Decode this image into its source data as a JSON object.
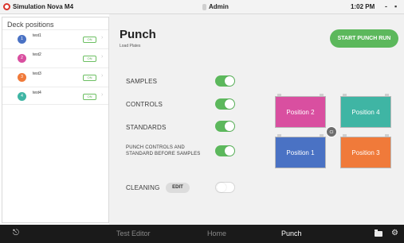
{
  "titlebar": {
    "app_name": "Simulation Nova M4",
    "user": "Admin",
    "time": "1:02 PM",
    "minimize": "-",
    "restore": "▪"
  },
  "sidebar": {
    "title": "Deck positions",
    "items": [
      {
        "num": "1",
        "name": "test1",
        "status": "ON",
        "color": "#4a72c4"
      },
      {
        "num": "2",
        "name": "test2",
        "status": "ON",
        "color": "#d94fa0"
      },
      {
        "num": "3",
        "name": "test3",
        "status": "ON",
        "color": "#f07a3a"
      },
      {
        "num": "4",
        "name": "test4",
        "status": "ON",
        "color": "#3fb5a4"
      }
    ]
  },
  "main": {
    "title": "Punch",
    "subtitle": "Load Plates",
    "start_button": "START PUNCH RUN",
    "options": [
      {
        "label": "SAMPLES",
        "on": true
      },
      {
        "label": "CONTROLS",
        "on": true
      },
      {
        "label": "STANDARDS",
        "on": true
      },
      {
        "label": "PUNCH CONTROLS AND STANDARD BEFORE SAMPLES",
        "on": true
      }
    ],
    "cleaning": {
      "label": "CLEANING",
      "edit": "EDIT",
      "on": false
    }
  },
  "positions": [
    {
      "label": "Position 2",
      "color": "#d94fa0"
    },
    {
      "label": "Position 4",
      "color": "#3fb5a4"
    },
    {
      "label": "Position 1",
      "color": "#4a72c4"
    },
    {
      "label": "Position 3",
      "color": "#f07a3a"
    }
  ],
  "ci_badge": "CI",
  "bottomnav": {
    "items": [
      "Test Editor",
      "Home",
      "Punch"
    ],
    "active": "Punch",
    "logout_icon": "logout-icon",
    "folder_icon": "folder-icon",
    "settings_icon": "gear-icon"
  }
}
